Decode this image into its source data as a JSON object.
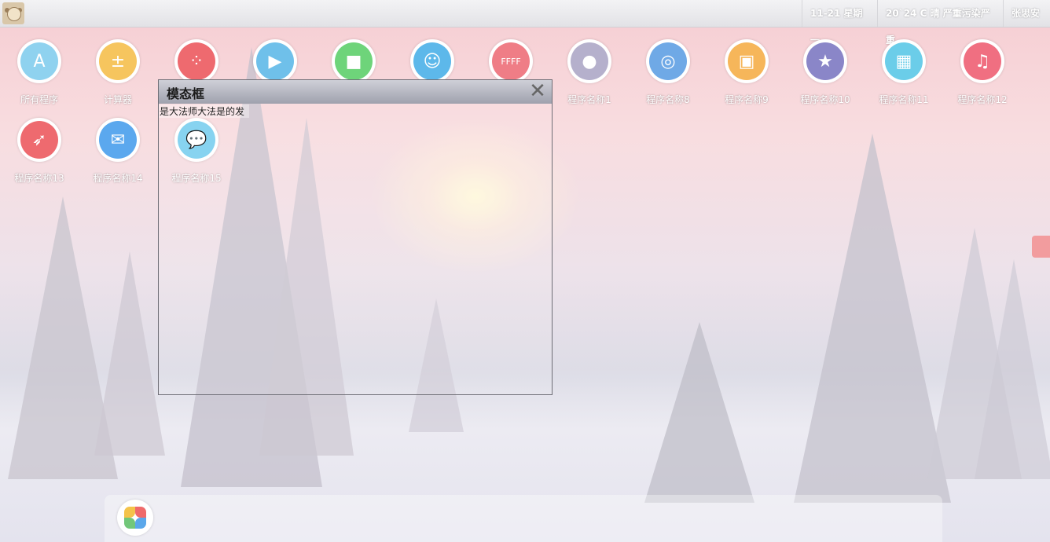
{
  "topbar": {
    "date": "11-21 星期一",
    "weather": "20`24 C 晴 严重污染严重",
    "user": "张思安"
  },
  "apps": [
    {
      "label": "所有程序",
      "icon": "app-store-icon",
      "color": "#8fd2ef",
      "glyph": "A"
    },
    {
      "label": "计算器",
      "icon": "calculator-icon",
      "color": "#f6c55e",
      "glyph": "±"
    },
    {
      "label": "",
      "icon": "game-center-icon",
      "color": "#ee6a6f",
      "glyph": "⁘"
    },
    {
      "label": "",
      "icon": "media-player-icon",
      "color": "#6fc0ea",
      "glyph": "▶"
    },
    {
      "label": "",
      "icon": "facetime-icon",
      "color": "#6ed47a",
      "glyph": "■"
    },
    {
      "label": "",
      "icon": "finder-icon",
      "color": "#5db8ea",
      "glyph": "☺"
    },
    {
      "label": "",
      "icon": "ffff-icon",
      "color": "#ef7d86",
      "glyph": "FFFF"
    },
    {
      "label": "程序名称1",
      "icon": "bubbles-icon",
      "color": "#b5b0cc",
      "glyph": "●"
    },
    {
      "label": "程序名称8",
      "icon": "dvd-icon",
      "color": "#6fa9e6",
      "glyph": "◎"
    },
    {
      "label": "程序名称9",
      "icon": "photo-booth-icon",
      "color": "#f6b65a",
      "glyph": "▣"
    },
    {
      "label": "程序名称10",
      "icon": "star-icon",
      "color": "#8a86c8",
      "glyph": "★"
    },
    {
      "label": "程序名称11",
      "icon": "photos-icon",
      "color": "#6bcde9",
      "glyph": "▦"
    },
    {
      "label": "程序名称12",
      "icon": "music-icon",
      "color": "#f06f81",
      "glyph": "♫"
    },
    {
      "label": "程序名称13",
      "icon": "rocket-icon",
      "color": "#ee6a6f",
      "glyph": "➶"
    },
    {
      "label": "程序名称14",
      "icon": "mail-icon",
      "color": "#5ba8ee",
      "glyph": "✉"
    },
    {
      "label": "程序名称15",
      "icon": "messages-icon",
      "color": "#7dd0ef",
      "glyph": "💬"
    }
  ],
  "modal": {
    "title": "模态框",
    "close_glyph": "✕",
    "body": "是大法师大法是的发"
  },
  "dock": {
    "icon": "photos-pinwheel-icon"
  }
}
